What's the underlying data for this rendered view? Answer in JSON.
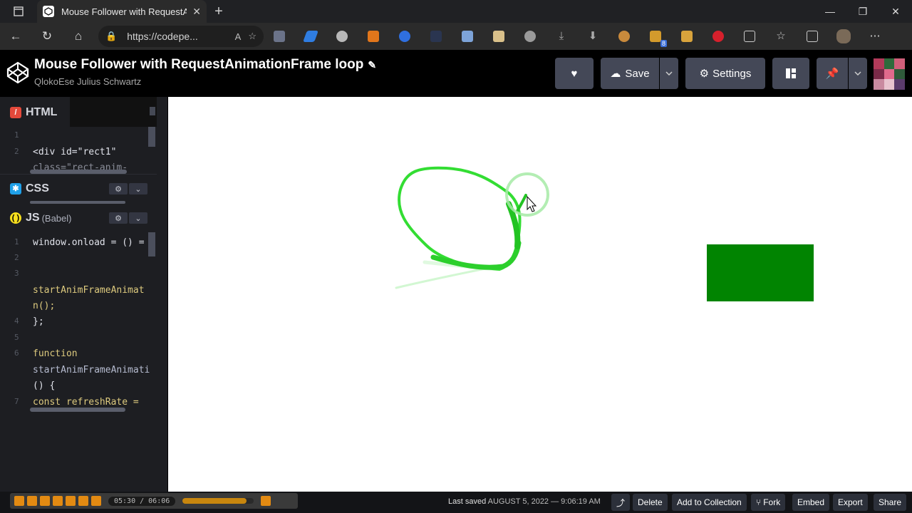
{
  "browser": {
    "tab_title": "Mouse Follower with RequestAni",
    "url": "https://codepe...",
    "extension_badge": "8"
  },
  "codepen": {
    "pen_title": "Mouse Follower with RequestAnimationFrame loop",
    "author": "QlokoEse Julius Schwartz",
    "save_label": "Save",
    "settings_label": "Settings"
  },
  "editors": {
    "html": {
      "label": "HTML",
      "lines": [
        {
          "num": "1",
          "text": ""
        },
        {
          "num": "2",
          "text": "<div id=\"rect1\""
        },
        {
          "num": "",
          "text": "class=\"rect-anim-"
        }
      ]
    },
    "css": {
      "label": "CSS"
    },
    "js": {
      "label": "JS",
      "sublabel": "(Babel)",
      "lines": [
        {
          "num": "1",
          "text": "window.onload = () ="
        },
        {
          "num": "2",
          "text": ""
        },
        {
          "num": "3",
          "text": ""
        },
        {
          "num": "",
          "text": " startAnimFrameAnimat"
        },
        {
          "num": "",
          "text": "n();"
        },
        {
          "num": "4",
          "text": "};"
        },
        {
          "num": "5",
          "text": ""
        },
        {
          "num": "6",
          "text": "function"
        },
        {
          "num": "",
          "text": "startAnimFrameAnimati"
        },
        {
          "num": "",
          "text": "() {"
        },
        {
          "num": "7",
          "text": "  const refreshRate ="
        }
      ]
    }
  },
  "media_player": {
    "time": "05:30 / 06:06",
    "progress": 0.9
  },
  "footer": {
    "last_saved_prefix": "Last saved",
    "last_saved_date": "AUGUST 5, 2022 — 9:06:19 AM",
    "delete": "Delete",
    "add_to_collection": "Add to Collection",
    "fork": "Fork",
    "embed": "Embed",
    "export": "Export",
    "share": "Share"
  },
  "colors": {
    "accent_green": "#018401",
    "trail_green": "#33dd33",
    "codepen_button": "#444857"
  }
}
